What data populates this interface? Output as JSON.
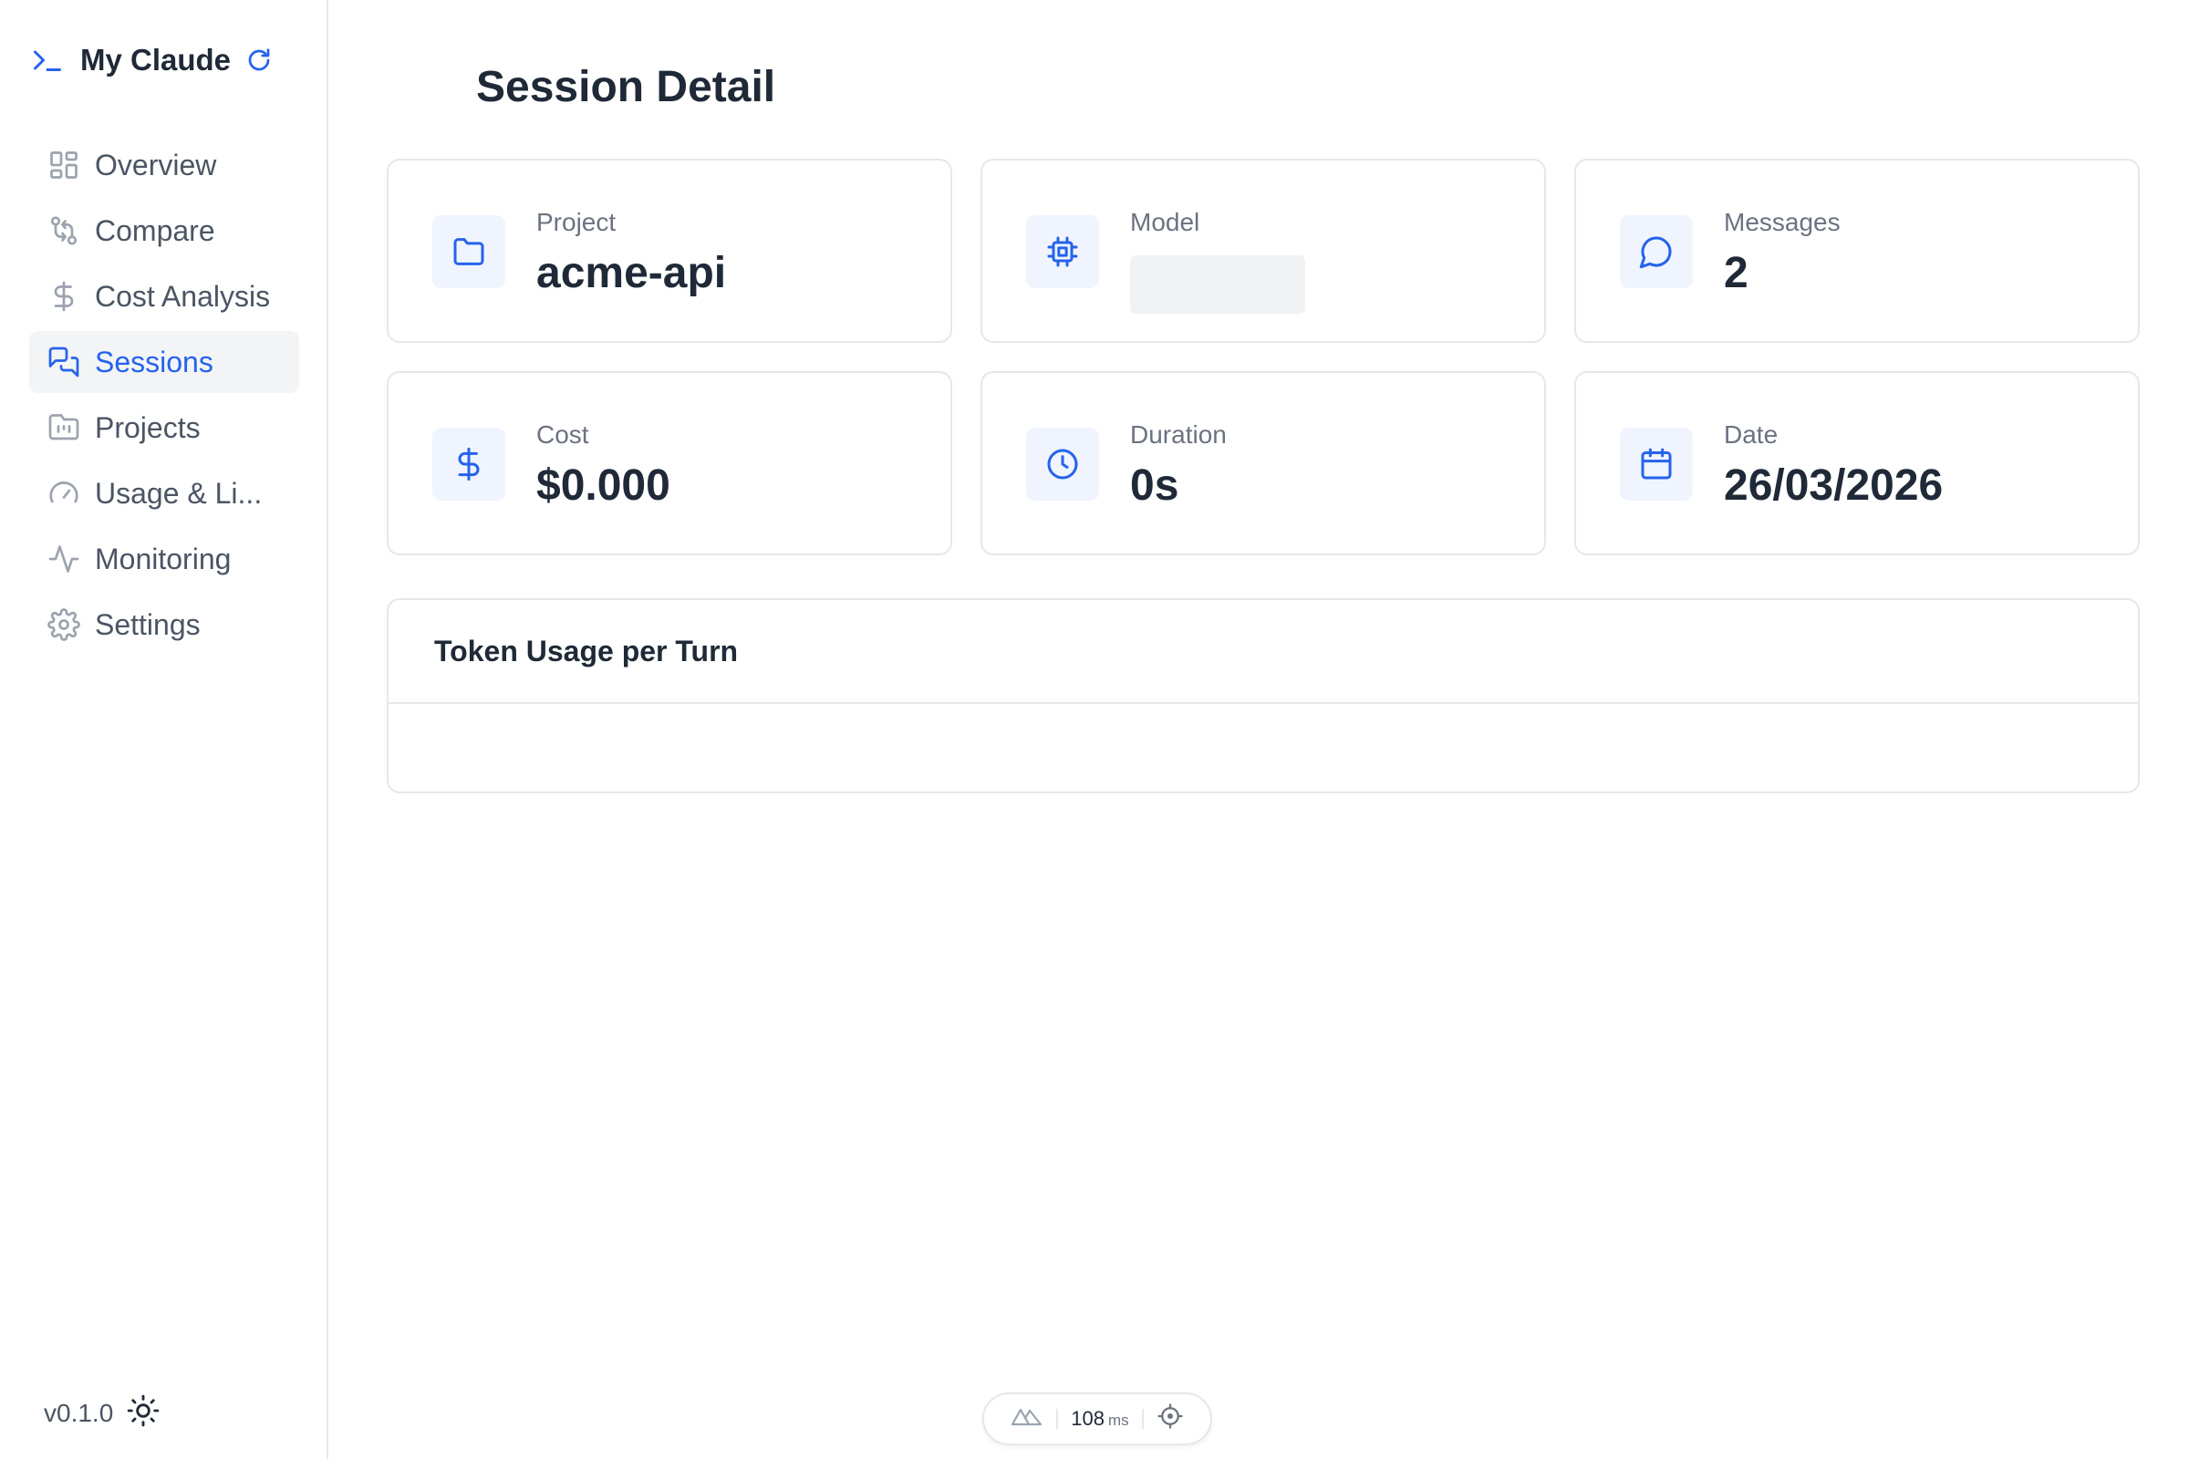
{
  "app": {
    "title": "My Claude",
    "version": "v0.1.0"
  },
  "sidebar": {
    "items": [
      {
        "label": "Overview",
        "icon": "layout-grid-icon",
        "active": false
      },
      {
        "label": "Compare",
        "icon": "git-compare-icon",
        "active": false
      },
      {
        "label": "Cost Analysis",
        "icon": "dollar-icon",
        "active": false
      },
      {
        "label": "Sessions",
        "icon": "chat-bubbles-icon",
        "active": true
      },
      {
        "label": "Projects",
        "icon": "folder-chart-icon",
        "active": false
      },
      {
        "label": "Usage & Li...",
        "icon": "gauge-icon",
        "active": false
      },
      {
        "label": "Monitoring",
        "icon": "activity-icon",
        "active": false
      },
      {
        "label": "Settings",
        "icon": "gear-icon",
        "active": false
      }
    ]
  },
  "page": {
    "title": "Session Detail"
  },
  "stats": {
    "project": {
      "label": "Project",
      "value": "acme-api"
    },
    "model": {
      "label": "Model",
      "value": ""
    },
    "messages": {
      "label": "Messages",
      "value": "2"
    },
    "cost": {
      "label": "Cost",
      "value": "$0.000"
    },
    "duration": {
      "label": "Duration",
      "value": "0s"
    },
    "date": {
      "label": "Date",
      "value": "26/03/2026"
    }
  },
  "token_chart": {
    "title": "Token Usage per Turn"
  },
  "devbar": {
    "time": "108",
    "unit": "ms"
  },
  "colors": {
    "accent": "#2563eb",
    "icon_bg": "#eff4fe",
    "border": "#e5e7eb",
    "muted": "#6b7280"
  }
}
